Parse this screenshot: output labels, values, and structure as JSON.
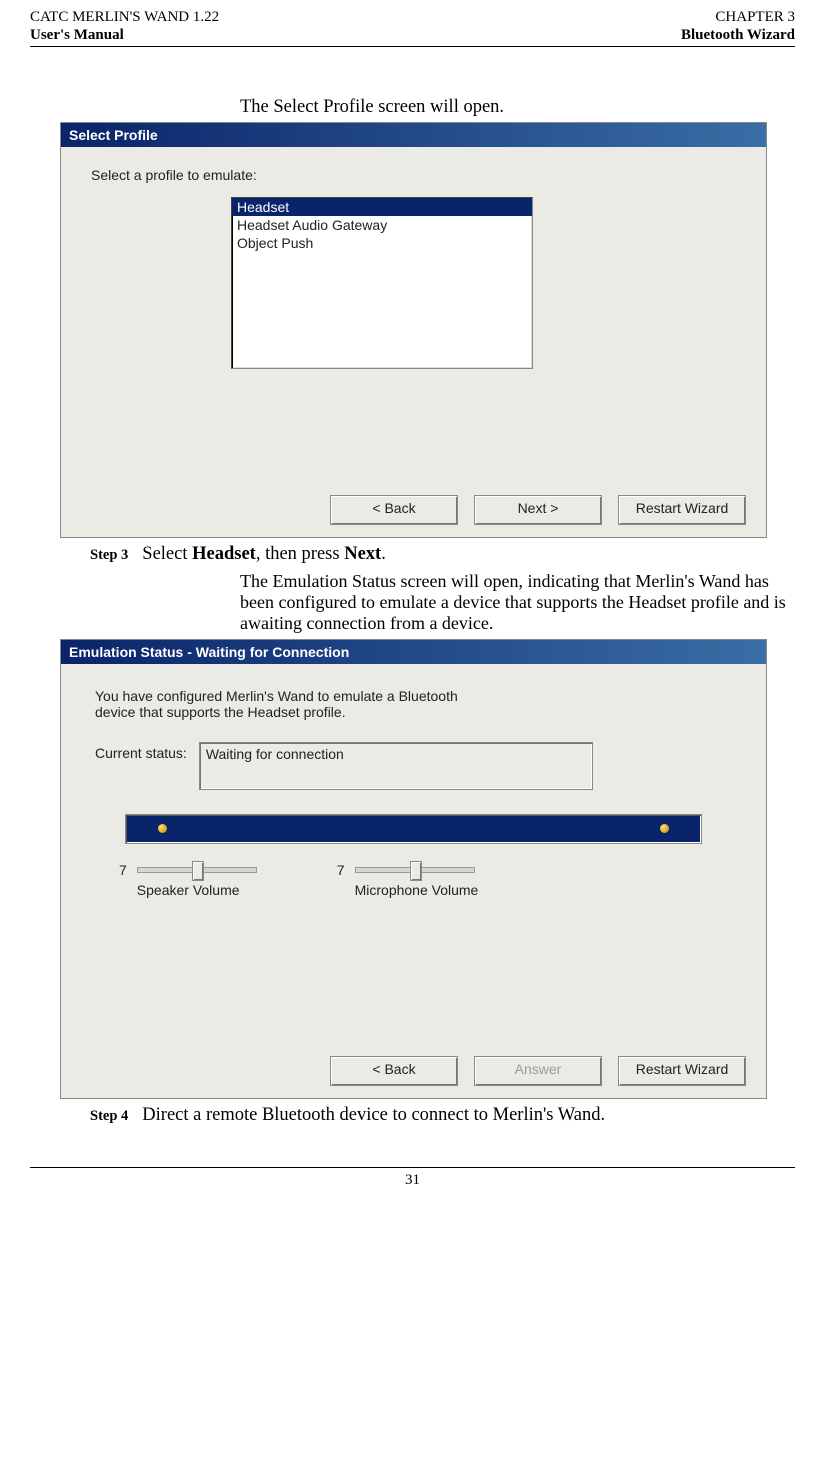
{
  "header": {
    "left_top": "CATC MERLIN'S WAND 1.22",
    "right_top": "CHAPTER 3",
    "left_bot": "User's Manual",
    "right_bot": "Bluetooth Wizard"
  },
  "intro_line": "The Select Profile screen will open.",
  "dialog1": {
    "title": "Select Profile",
    "prompt": "Select a profile to emulate:",
    "items": [
      "Headset",
      "Headset Audio Gateway",
      "Object Push"
    ],
    "buttons": {
      "back": "< Back",
      "next": "Next >",
      "restart": "Restart Wizard"
    }
  },
  "step3": {
    "label": "Step 3",
    "text_pre": "Select ",
    "bold1": "Headset",
    "text_mid": ", then press ",
    "bold2": "Next",
    "text_post": "."
  },
  "sub_para": "The Emulation Status screen will open, indicating that Merlin's Wand has been configured to emulate a device that supports the Headset profile and is awaiting connection from a device.",
  "dialog2": {
    "title": "Emulation Status - Waiting for Connection",
    "desc": "You have configured Merlin's Wand to emulate a Bluetooth device that supports the Headset profile.",
    "status_label": "Current status:",
    "status_value": "Waiting for connection",
    "slider1": {
      "value": "7",
      "label": "Speaker Volume"
    },
    "slider2": {
      "value": "7",
      "label": "Microphone Volume"
    },
    "buttons": {
      "back": "< Back",
      "answer": "Answer",
      "restart": "Restart Wizard"
    }
  },
  "step4": {
    "label": "Step 4",
    "text": "Direct a remote Bluetooth device to connect to Merlin's Wand."
  },
  "page_number": "31"
}
